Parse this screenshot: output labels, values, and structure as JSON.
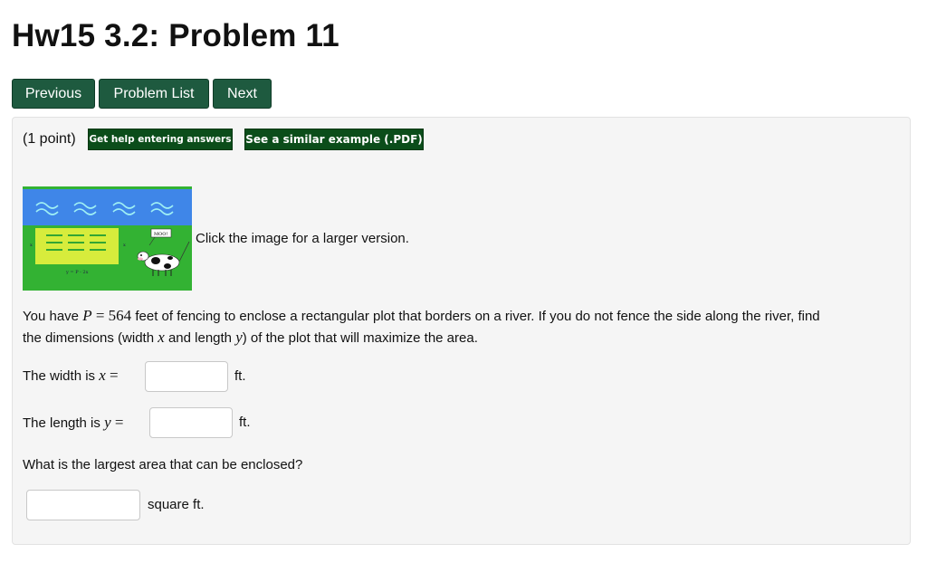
{
  "title": "Hw15 3.2: Problem 11",
  "nav": {
    "previous": "Previous",
    "problem_list": "Problem List",
    "next": "Next"
  },
  "problem": {
    "points": "(1 point)",
    "help_button": "Get help entering answers",
    "example_button": "See a similar example (.PDF)",
    "image_caption": "Click the image for a larger version.",
    "image": {
      "cow_speech": "MOO!",
      "equation": "y = P - 2x",
      "side_x": "x"
    },
    "statement": {
      "prefix": "You have ",
      "var_P": "P",
      "eq": " = ",
      "value": "564",
      "rest_line1": " feet of fencing to enclose a rectangular plot that borders on a river. If you do not fence the side along the river, find",
      "line2_a": "the dimensions (width ",
      "var_x": "x",
      "line2_b": " and length ",
      "var_y": "y",
      "line2_c": ") of the plot that will maximize the area."
    },
    "width_label": "The width is ",
    "width_var": "x",
    "width_eq": " =",
    "width_unit": "ft.",
    "width_value": "",
    "length_label": "The length is ",
    "length_var": "y",
    "length_eq": " =",
    "length_unit": "ft.",
    "length_value": "",
    "area_question": "What is the largest area that can be enclosed?",
    "area_unit": "square ft.",
    "area_value": ""
  },
  "colors": {
    "nav_button": "#1e5a3f",
    "green_button": "#0b4d1a",
    "panel": "#f5f5f5"
  }
}
